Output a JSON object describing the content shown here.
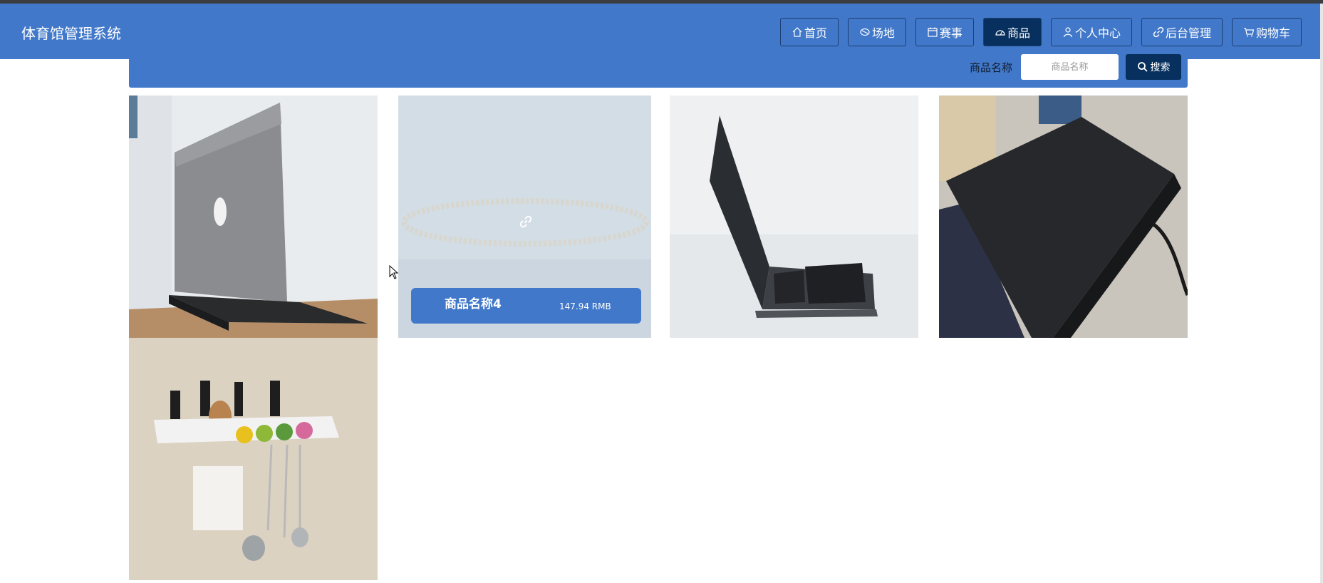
{
  "app": {
    "title": "体育馆管理系统"
  },
  "nav": {
    "items": [
      {
        "label": "首页",
        "icon": "home-icon"
      },
      {
        "label": "场地",
        "icon": "venue-icon"
      },
      {
        "label": "赛事",
        "icon": "calendar-icon"
      },
      {
        "label": "商品",
        "icon": "dashboard-icon",
        "active": true
      },
      {
        "label": "个人中心",
        "icon": "user-icon"
      },
      {
        "label": "后台管理",
        "icon": "link-icon"
      },
      {
        "label": "购物车",
        "icon": "cart-icon"
      }
    ]
  },
  "search": {
    "label": "商品名称",
    "placeholder": "商品名称",
    "button_label": "搜索"
  },
  "products": [
    {
      "image": "laptop-gray-rear"
    },
    {
      "image": "pearl-necklace",
      "hovered": true,
      "name": "商品名称4",
      "price": "147.94 RMB"
    },
    {
      "image": "dual-screen-laptop"
    },
    {
      "image": "black-laptop-lid"
    },
    {
      "image": "kitchen-utensil-rack"
    }
  ],
  "colors": {
    "primary": "#4178c9",
    "active": "#08305e"
  }
}
